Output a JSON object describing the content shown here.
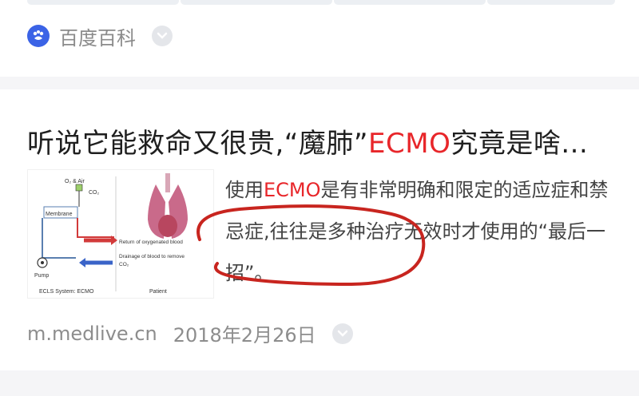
{
  "top_card": {
    "source_name": "百度百科",
    "source_icon": "baike-paw-icon",
    "more_icon": "chevron-down-icon"
  },
  "result": {
    "title_before": "听说它能救命又很贵,“魔肺”",
    "title_highlight": "ECMO",
    "title_after": "究竟是啥...",
    "snippet_before": "使用",
    "snippet_highlight": "ECMO",
    "snippet_after": "是有非常明确和限定的适应症和禁忌症,往往是多种治疗无效时才使用的“最后一招”。",
    "domain": "m.medlive.cn",
    "date": "2018年2月26日",
    "more_icon": "chevron-down-icon"
  },
  "thumbnail": {
    "labels": {
      "o2_air": "O₂ & Air",
      "co2": "CO₂",
      "membrane": "Membrane",
      "return": "Return of oxygenated blood",
      "drainage": "Drainage of blood to remove",
      "co2_2": "CO₂",
      "pump": "Pump",
      "ecls": "ECLS System: ECMO",
      "patient": "Patient"
    }
  },
  "colors": {
    "highlight": "#e8262a",
    "baike_blue": "#3b63e6",
    "annotation_red": "#c8251f"
  }
}
